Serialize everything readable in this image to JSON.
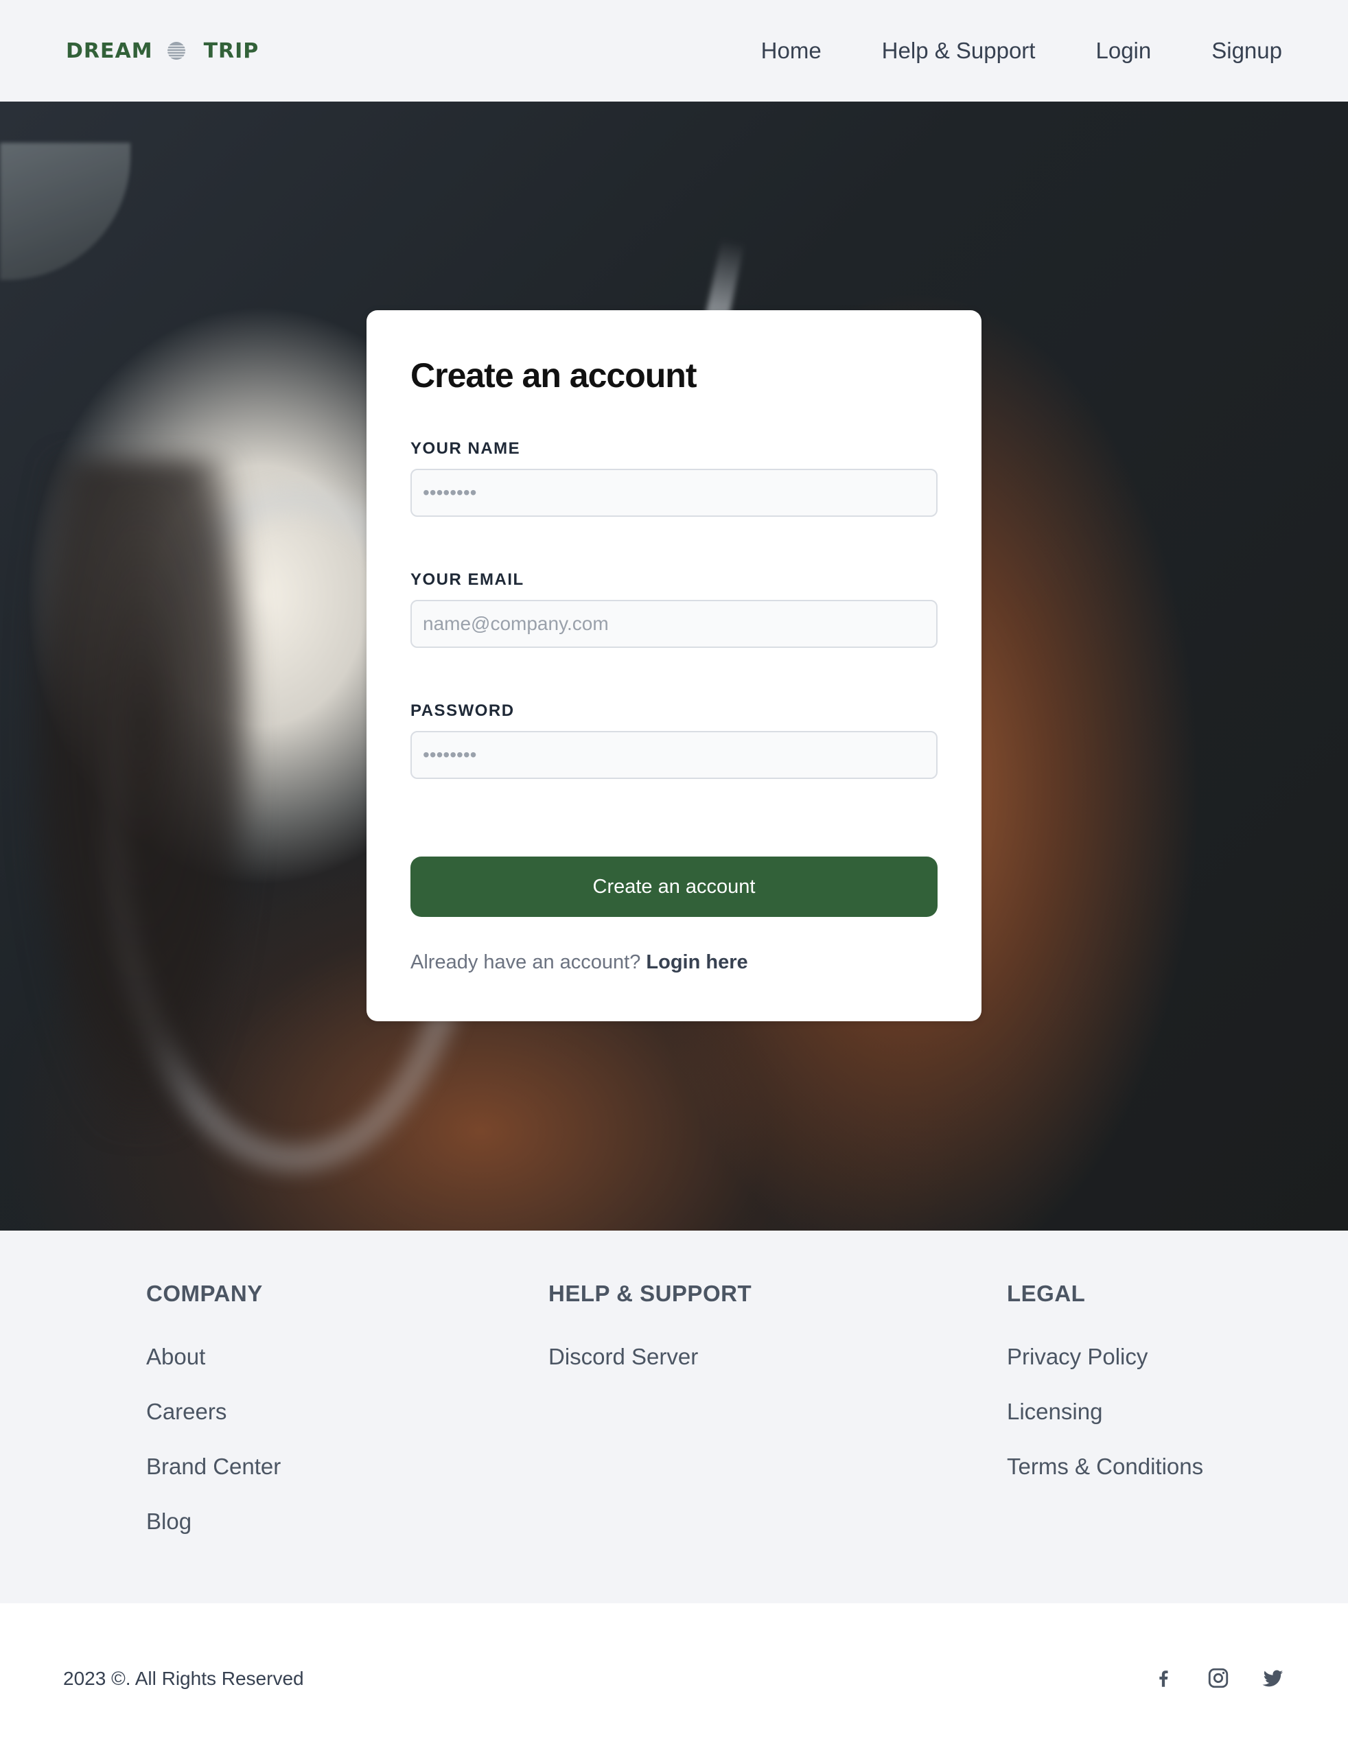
{
  "header": {
    "logo_left": "DREAM",
    "logo_right": "TRIP",
    "logo_icon": "globe-icon",
    "nav": [
      {
        "label": "Home"
      },
      {
        "label": "Help & Support"
      },
      {
        "label": "Login"
      },
      {
        "label": "Signup"
      }
    ]
  },
  "form": {
    "title": "Create an account",
    "name_label": "YOUR NAME",
    "name_placeholder": "••••••••",
    "email_label": "YOUR EMAIL",
    "email_placeholder": "name@company.com",
    "password_label": "PASSWORD",
    "password_placeholder": "••••••••",
    "submit_label": "Create an account",
    "login_prompt": "Already have an account?",
    "login_link": "Login here"
  },
  "footer": {
    "columns": [
      {
        "heading": "COMPANY",
        "links": [
          "About",
          "Careers",
          "Brand Center",
          "Blog"
        ]
      },
      {
        "heading": "HELP & SUPPORT",
        "links": [
          "Discord Server"
        ]
      },
      {
        "heading": "LEGAL",
        "links": [
          "Privacy Policy",
          "Licensing",
          "Terms & Conditions"
        ]
      }
    ],
    "copyright": "2023 ©. All Rights Reserved",
    "socials": [
      "facebook-icon",
      "instagram-icon",
      "twitter-icon"
    ]
  },
  "colors": {
    "brand_green": "#326139",
    "page_bg": "#f3f4f7",
    "text": "#374151"
  }
}
